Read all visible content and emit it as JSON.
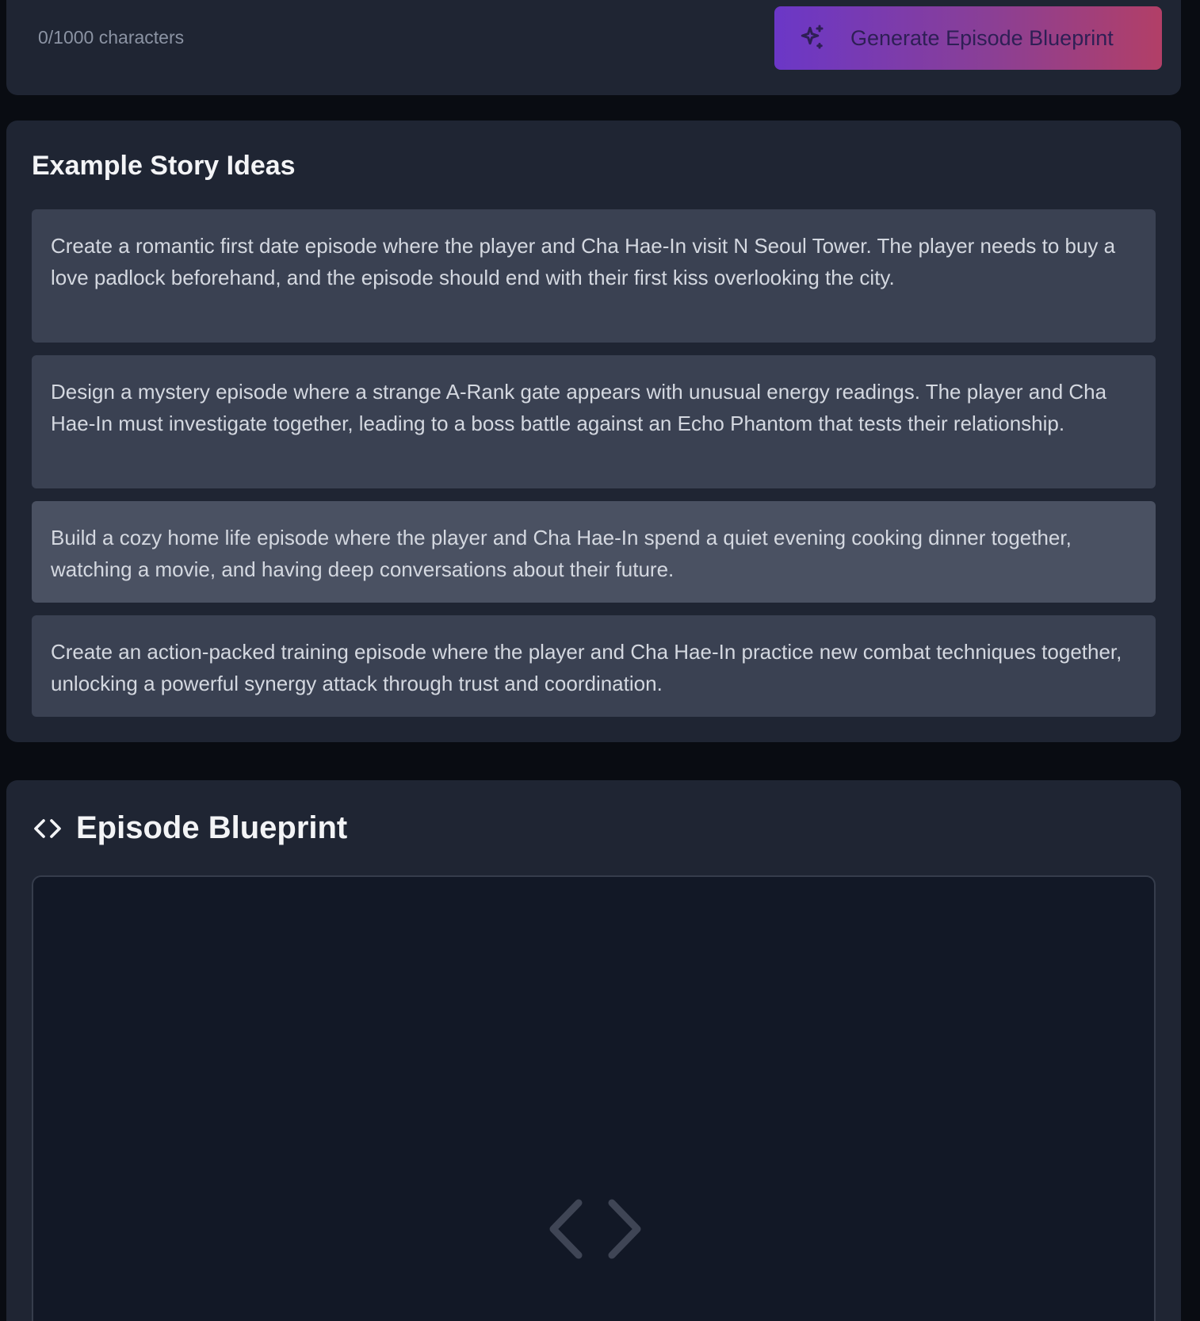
{
  "input": {
    "char_count": "0/1000 characters"
  },
  "generate_button": {
    "label": "Generate Episode Blueprint",
    "icon": "sparkles-icon"
  },
  "examples": {
    "title": "Example Story Ideas",
    "items": [
      {
        "text": "Create a romantic first date episode where the player and Cha Hae-In visit N Seoul Tower. The player needs to buy a love padlock beforehand, and the episode should end with their first kiss overlooking the city."
      },
      {
        "text": "Design a mystery episode where a strange A-Rank gate appears with unusual energy readings. The player and Cha Hae-In must investigate together, leading to a boss battle against an Echo Phantom that tests their relationship."
      },
      {
        "text": "Build a cozy home life episode where the player and Cha Hae-In spend a quiet evening cooking dinner together, watching a movie, and having deep conversations about their future."
      },
      {
        "text": "Create an action-packed training episode where the player and Cha Hae-In practice new combat techniques together, unlocking a powerful synergy attack through trust and coordination."
      }
    ]
  },
  "blueprint": {
    "title": "Episode Blueprint",
    "icon": "code-icon",
    "placeholder_icon": "code-icon"
  },
  "colors": {
    "background": "#090c12",
    "card": "#1f2533",
    "idea_card": "#3a4152",
    "idea_card_hover": "#4a5162",
    "button_gradient_start": "#6b37c7",
    "button_gradient_end": "#b23f67"
  }
}
